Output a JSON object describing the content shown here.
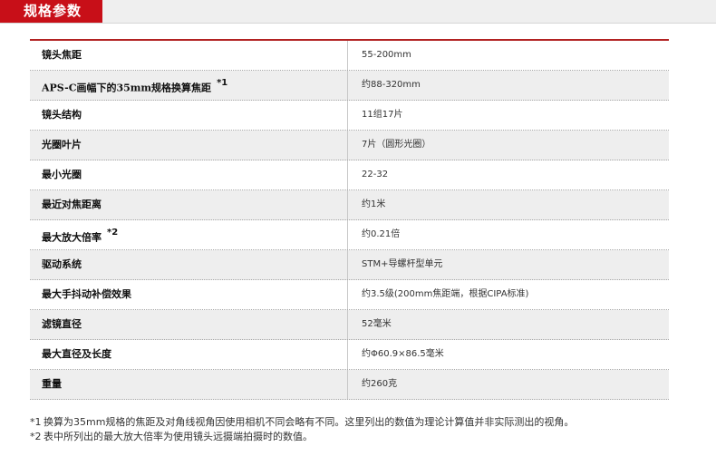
{
  "header": {
    "title": "规格参数"
  },
  "specs": [
    {
      "label": "镜头焦距",
      "sup": "",
      "value": "55-200mm"
    },
    {
      "label": "APS-C画幅下的35mm规格换算焦距",
      "sup": "*1",
      "value": "约88-320mm"
    },
    {
      "label": "镜头结构",
      "sup": "",
      "value": "11组17片"
    },
    {
      "label": "光圈叶片",
      "sup": "",
      "value": "7片（圆形光圈）"
    },
    {
      "label": "最小光圈",
      "sup": "",
      "value": "22-32"
    },
    {
      "label": "最近对焦距离",
      "sup": "",
      "value": "约1米"
    },
    {
      "label": "最大放大倍率",
      "sup": "*2",
      "value": "约0.21倍"
    },
    {
      "label": "驱动系统",
      "sup": "",
      "value": "STM+导螺杆型单元"
    },
    {
      "label": "最大手抖动补偿效果",
      "sup": "",
      "value": "约3.5级(200mm焦距端，根据CIPA标准)"
    },
    {
      "label": "滤镜直径",
      "sup": "",
      "value": "52毫米"
    },
    {
      "label": "最大直径及长度",
      "sup": "",
      "value": "约Φ60.9×86.5毫米"
    },
    {
      "label": "重量",
      "sup": "",
      "value": "约260克"
    }
  ],
  "notes": [
    {
      "mark": "*1",
      "text": "换算为35mm规格的焦距及对角线视角因使用相机不同会略有不同。这里列出的数值为理论计算值并非实际测出的视角。"
    },
    {
      "mark": "*2",
      "text": "表中所列出的最大放大倍率为使用镜头远摄端拍摄时的数值。"
    }
  ]
}
